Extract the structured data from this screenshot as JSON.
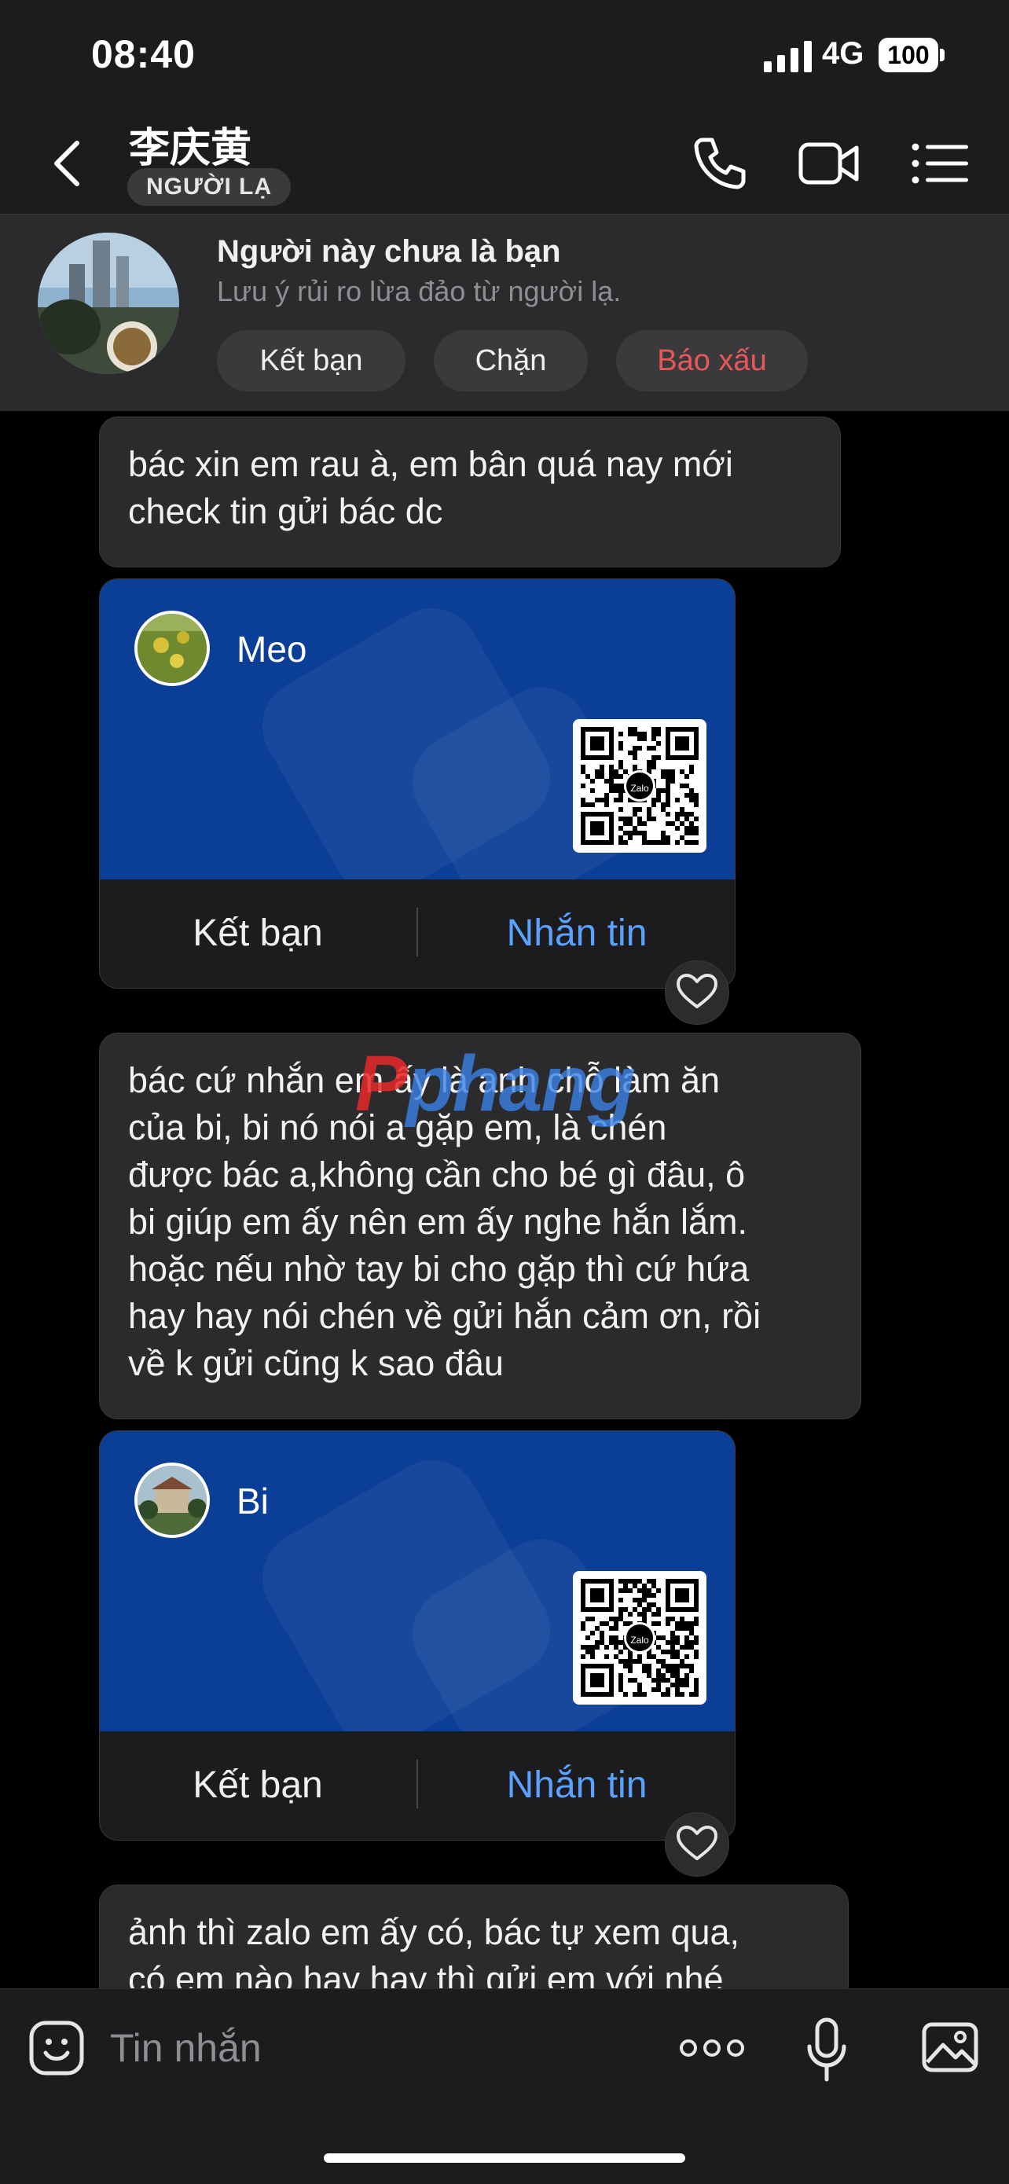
{
  "status_bar": {
    "time": "08:40",
    "network": "4G",
    "battery": "100"
  },
  "header": {
    "contact_name": "李庆黄",
    "badge": "NGƯỜI LẠ",
    "icons": [
      "back-icon",
      "phone-icon",
      "video-icon",
      "menu-icon"
    ]
  },
  "banner": {
    "title": "Người này chưa là bạn",
    "subtitle": "Lưu ý rủi ro lừa đảo từ người lạ.",
    "add_friend": "Kết bạn",
    "block": "Chặn",
    "report": "Báo xấu",
    "report_color": "#e8585a"
  },
  "messages": [
    {
      "text": "bác xin em rau à, em bân quá nay mới\ncheck tin gửi bác dc"
    },
    {
      "text": "bác cứ nhắn em ấy là anh chỗ làm ăn\ncủa bi, bi nó nói a gặp em, là chén\nđược bác a,không cần cho bé gì đâu,  ô\nbi giúp em ấy nên em ấy nghe hắn lắm.\nhoặc nếu nhờ tay bi cho gặp thì cứ hứa\nhay hay nói chén về gửi hắn cảm ơn, rồi\nvề k gửi cũng k sao đâu"
    },
    {
      "text": "ảnh thì zalo em ấy có, bác tự xem qua,\ncó em nào hay hay thì gửi em với nhé"
    }
  ],
  "cards": [
    {
      "name": "Meo",
      "qr_label": "Zalo",
      "add_friend": "Kết bạn",
      "message": "Nhắn tin"
    },
    {
      "name": "Bi",
      "qr_label": "Zalo",
      "add_friend": "Kết bạn",
      "message": "Nhắn tin"
    }
  ],
  "watermark": {
    "prefix": "P",
    "rest": "phang"
  },
  "input": {
    "placeholder": "Tin nhắn"
  },
  "colors": {
    "card_bg": "#0b3f97",
    "link_blue": "#5aa2ff",
    "bubble_bg": "#2b2b2e"
  }
}
